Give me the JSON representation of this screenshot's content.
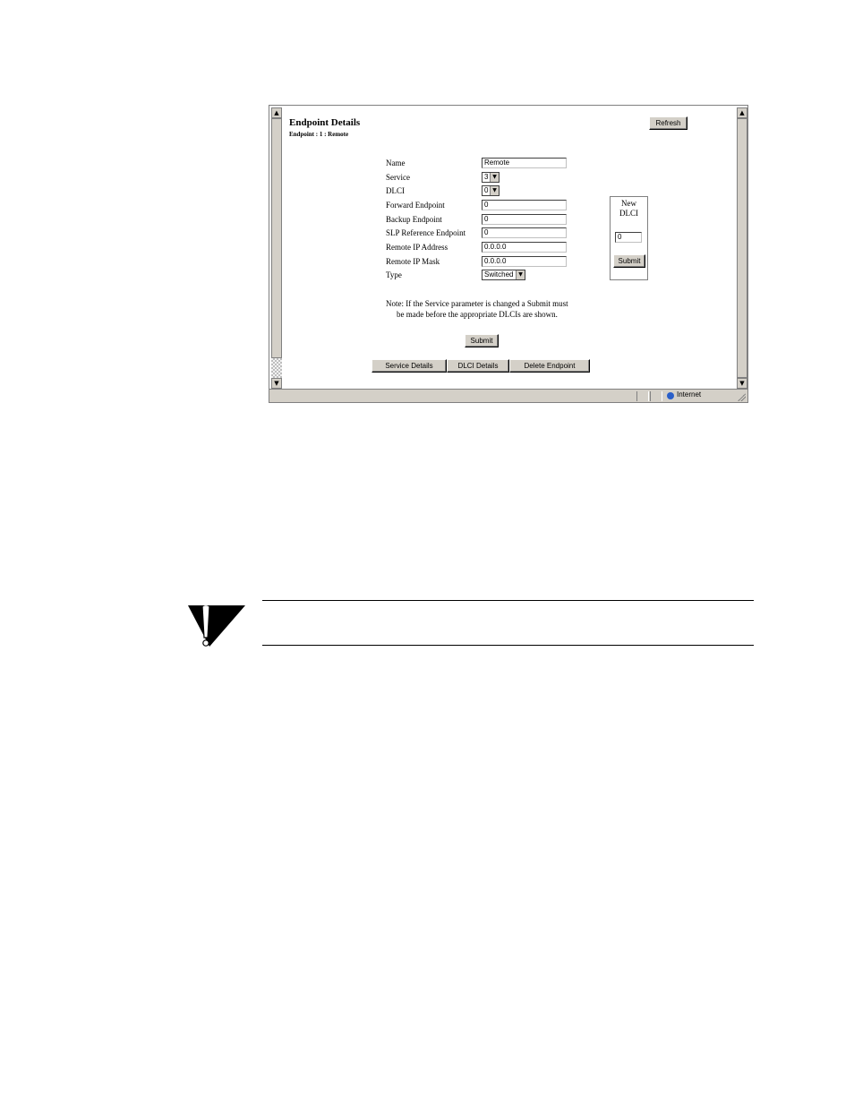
{
  "page": {
    "title": "Endpoint Details",
    "subtitle": "Endpoint : 1 : Remote",
    "refresh_label": "Refresh"
  },
  "form": {
    "fields": [
      {
        "label": "Name",
        "value": "Remote",
        "kind": "text"
      },
      {
        "label": "Service",
        "value": "3",
        "kind": "select"
      },
      {
        "label": "DLCI",
        "value": "0",
        "kind": "select"
      },
      {
        "label": "Forward Endpoint",
        "value": "0",
        "kind": "text"
      },
      {
        "label": "Backup Endpoint",
        "value": "0",
        "kind": "text"
      },
      {
        "label": "SLP Reference Endpoint",
        "value": "0",
        "kind": "text"
      },
      {
        "label": "Remote IP Address",
        "value": "0.0.0.0",
        "kind": "text"
      },
      {
        "label": "Remote IP Mask",
        "value": "0.0.0.0",
        "kind": "text"
      },
      {
        "label": "Type",
        "value": "Switched",
        "kind": "select"
      }
    ],
    "note_line1": "Note:  If the Service parameter is changed a Submit must",
    "note_line2": "be made before the appropriate DLCIs are shown.",
    "submit_label": "Submit"
  },
  "new_dlci": {
    "label_line1": "New",
    "label_line2": "DLCI",
    "value": "0",
    "submit_label": "Submit"
  },
  "nav_buttons": [
    "Service Details",
    "DLCI Details",
    "Delete Endpoint"
  ],
  "statusbar": {
    "zone": "Internet",
    "zone_icon": "globe-icon"
  },
  "caution_icon": "caution-exclamation-icon"
}
